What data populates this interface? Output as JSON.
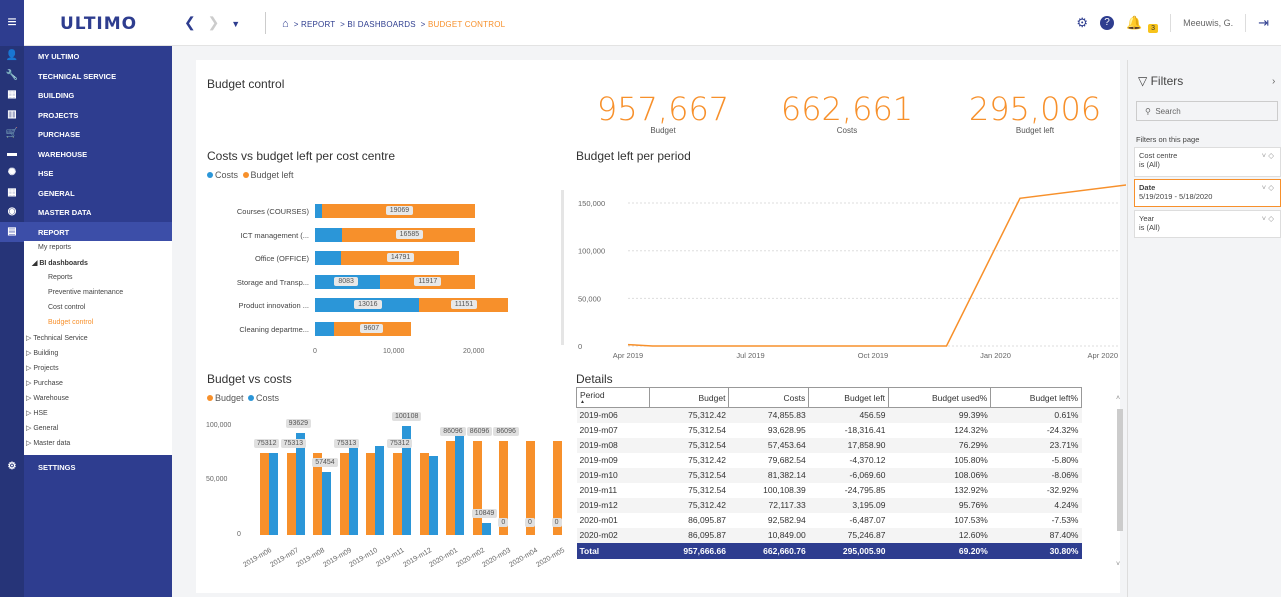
{
  "app": {
    "logo": "ULTIMO"
  },
  "breadcrumb": {
    "items": [
      "REPORT",
      "BI DASHBOARDS"
    ],
    "current": "BUDGET CONTROL"
  },
  "topright": {
    "notifications": "3",
    "user": "Meeuwis, G."
  },
  "sidebar": {
    "items": [
      {
        "label": "MY ULTIMO",
        "icon": "person-icon"
      },
      {
        "label": "TECHNICAL SERVICE",
        "icon": "wrench-icon"
      },
      {
        "label": "BUILDING",
        "icon": "building-icon"
      },
      {
        "label": "PROJECTS",
        "icon": "projects-icon"
      },
      {
        "label": "PURCHASE",
        "icon": "cart-icon"
      },
      {
        "label": "WAREHOUSE",
        "icon": "warehouse-icon"
      },
      {
        "label": "HSE",
        "icon": "hse-icon"
      },
      {
        "label": "GENERAL",
        "icon": "grid-icon"
      },
      {
        "label": "MASTER DATA",
        "icon": "database-icon"
      },
      {
        "label": "REPORT",
        "icon": "report-icon"
      }
    ],
    "settings": "SETTINGS",
    "sub": {
      "my_reports": "My reports",
      "bi_dashboards": "◢ BI dashboards",
      "bi_items": [
        "Reports",
        "Preventive maintenance",
        "Cost control",
        "Budget control"
      ],
      "groups": [
        "▷ Technical Service",
        "▷ Building",
        "▷ Projects",
        "▷ Purchase",
        "▷ Warehouse",
        "▷ HSE",
        "▷ General",
        "▷ Master data"
      ]
    }
  },
  "main": {
    "title": "Budget control",
    "kpis": [
      {
        "value": "957,667",
        "label": "Budget"
      },
      {
        "value": "662,661",
        "label": "Costs"
      },
      {
        "value": "295,006",
        "label": "Budget left"
      }
    ]
  },
  "colors": {
    "costs": "#2b96d8",
    "budget": "#f7902b",
    "brand": "#2e3d8f"
  },
  "chart_data": [
    {
      "type": "bar",
      "orientation": "horizontal",
      "stacked": true,
      "title": "Costs vs budget left per cost centre",
      "legend": [
        "Costs",
        "Budget left"
      ],
      "categories": [
        "Courses (COURSES)",
        "ICT management (...",
        "Office (OFFICE)",
        "Storage and Transp...",
        "Product innovation ...",
        "Cleaning departme..."
      ],
      "series": [
        {
          "name": "Costs",
          "values": [
            930,
            3415,
            3209,
            8083,
            13016,
            2393
          ]
        },
        {
          "name": "Budget left",
          "values": [
            19069,
            16585,
            14791,
            11917,
            11151,
            9607
          ]
        }
      ],
      "data_labels": [
        {
          "costs": "",
          "left": "19069"
        },
        {
          "costs": "",
          "left": "16585"
        },
        {
          "costs": "",
          "left": "14791"
        },
        {
          "costs": "8083",
          "left": "11917"
        },
        {
          "costs": "13016",
          "left": "11151"
        },
        {
          "costs": "",
          "left": "9607"
        }
      ],
      "xticks": [
        "0",
        "10,000",
        "20,000"
      ],
      "xlim": [
        0,
        24000
      ]
    },
    {
      "type": "line",
      "title": "Budget left per period",
      "x": [
        "2019-05",
        "2019-06",
        "2019-07",
        "2019-08",
        "2019-09",
        "2019-10",
        "2019-11",
        "2019-12",
        "2020-01",
        "2020-02",
        "2020-03",
        "2020-04",
        "2020-05"
      ],
      "xticks": [
        "Apr 2019",
        "Jul 2019",
        "Oct 2019",
        "Jan 2020",
        "Apr 2020"
      ],
      "yticks": [
        "0",
        "50,000",
        "100,000",
        "150,000"
      ],
      "ylim": [
        0,
        170000
      ]
    },
    {
      "type": "bar",
      "title": "Budget vs costs",
      "legend": [
        "Budget",
        "Costs"
      ],
      "categories": [
        "2019-m06",
        "2019-m07",
        "2019-m08",
        "2019-m09",
        "2019-m10",
        "2019-m11",
        "2019-m12",
        "2020-m01",
        "2020-m02",
        "2020-m03",
        "2020-m04",
        "2020-m05"
      ],
      "series": [
        {
          "name": "Budget",
          "values": [
            75312,
            75313,
            75313,
            75312,
            75313,
            75313,
            75312,
            86096,
            86096,
            86096,
            86096,
            86096
          ]
        },
        {
          "name": "Costs",
          "values": [
            74856,
            93629,
            57454,
            79683,
            81382,
            100108,
            72117,
            92583,
            10849,
            0,
            0,
            0
          ]
        }
      ],
      "budget_labels": [
        "75312",
        "75313",
        "",
        "75313",
        "",
        "75312",
        "",
        "86096",
        "86096",
        "86096",
        "",
        ""
      ],
      "costs_labels": [
        "",
        "93629",
        "57454",
        "",
        "",
        "100108",
        "",
        "",
        "10849",
        "0",
        "0",
        "0"
      ],
      "yticks": [
        "0",
        "50,000",
        "100,000"
      ],
      "ylim": [
        0,
        110000
      ]
    }
  ],
  "details": {
    "title": "Details",
    "columns": [
      "Period",
      "Budget",
      "Costs",
      "Budget left",
      "Budget used%",
      "Budget left%"
    ],
    "rows": [
      [
        "2019-m06",
        "75,312.42",
        "74,855.83",
        "456.59",
        "99.39%",
        "0.61%"
      ],
      [
        "2019-m07",
        "75,312.54",
        "93,628.95",
        "-18,316.41",
        "124.32%",
        "-24.32%"
      ],
      [
        "2019-m08",
        "75,312.54",
        "57,453.64",
        "17,858.90",
        "76.29%",
        "23.71%"
      ],
      [
        "2019-m09",
        "75,312.42",
        "79,682.54",
        "-4,370.12",
        "105.80%",
        "-5.80%"
      ],
      [
        "2019-m10",
        "75,312.54",
        "81,382.14",
        "-6,069.60",
        "108.06%",
        "-8.06%"
      ],
      [
        "2019-m11",
        "75,312.54",
        "100,108.39",
        "-24,795.85",
        "132.92%",
        "-32.92%"
      ],
      [
        "2019-m12",
        "75,312.42",
        "72,117.33",
        "3,195.09",
        "95.76%",
        "4.24%"
      ],
      [
        "2020-m01",
        "86,095.87",
        "92,582.94",
        "-6,487.07",
        "107.53%",
        "-7.53%"
      ],
      [
        "2020-m02",
        "86,095.87",
        "10,849.00",
        "75,246.87",
        "12.60%",
        "87.40%"
      ]
    ],
    "total": [
      "Total",
      "957,666.66",
      "662,660.76",
      "295,005.90",
      "69.20%",
      "30.80%"
    ]
  },
  "filters": {
    "title": "Filters",
    "search_placeholder": "Search",
    "section": "Filters on this page",
    "items": [
      {
        "name": "Cost centre",
        "value": "is (All)"
      },
      {
        "name": "Date",
        "value": "5/19/2019 - 5/18/2020"
      },
      {
        "name": "Year",
        "value": "is (All)"
      }
    ]
  }
}
